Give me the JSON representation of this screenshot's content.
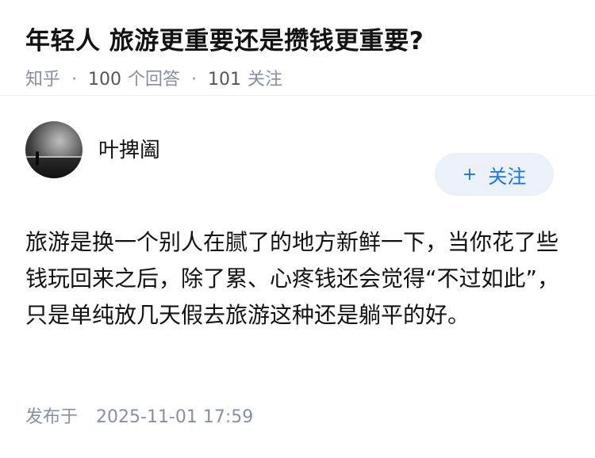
{
  "question": {
    "title": "年轻人 旅游更重要还是攒钱更重要?",
    "source": "知乎",
    "answer_count": "100",
    "answer_label": "个回答",
    "follower_count": "101",
    "follower_label": "关注"
  },
  "answer": {
    "author_name": "叶捭阖",
    "follow_button": {
      "icon": "plus-icon",
      "plus": "+",
      "label": "关注"
    },
    "content": "旅游是换一个别人在腻了的地方新鲜一下，当你花了些钱玩回来之后，除了累、心疼钱还会觉得“不过如此”，只是单纯放几天假去旅游这种还是躺平的好。",
    "published_label": "发布于",
    "published_time": "2025-11-01 17:59"
  },
  "colors": {
    "accent": "#1772f6",
    "follow_bg": "#eaf1f9",
    "meta_gray": "#8590a6"
  }
}
